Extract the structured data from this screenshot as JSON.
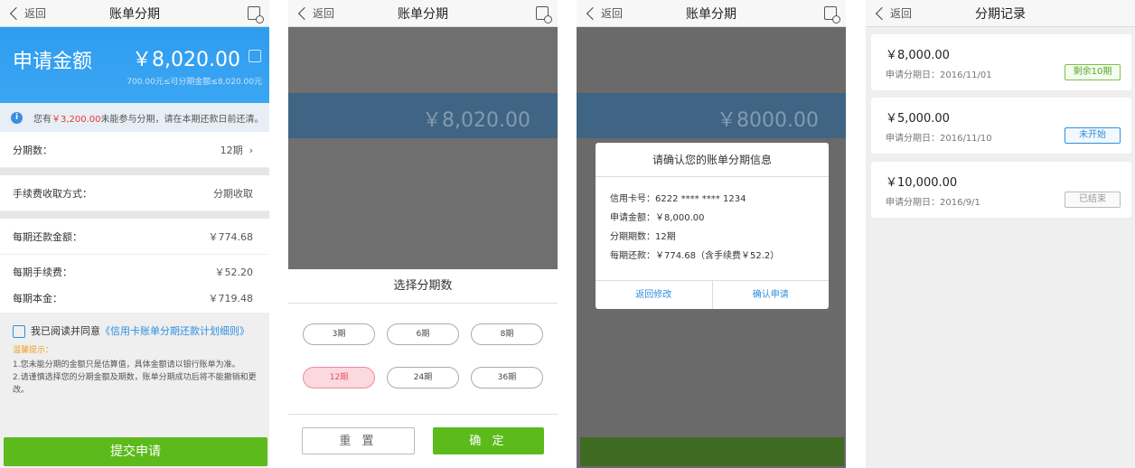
{
  "screen1": {
    "back": "返回",
    "title": "账单分期",
    "hero_label": "申请金额",
    "hero_amount": "￥8,020.00",
    "hero_range": "700.00元≤可分期金额≤8,020.00元",
    "notice_pre": "您有",
    "notice_amount": "￥3,200.00",
    "notice_post": "未能参与分期，请在本期还款日前还清。",
    "rows": [
      {
        "label": "分期数：",
        "value": "12期"
      },
      {
        "label": "手续费收取方式：",
        "value": "分期收取"
      },
      {
        "label": "每期还款金额：",
        "value": "￥774.68"
      },
      {
        "label": "每期手续费：",
        "value": "￥52.20"
      },
      {
        "label": "每期本金：",
        "value": "￥719.48"
      }
    ],
    "agree_text": "我已阅读并同意",
    "agree_link": "《信用卡账单分期还款计划细则》",
    "tips_title": "温馨提示：",
    "tip1": "1.您未能分期的金额只是估算值，具体金额请以银行账单为准。",
    "tip2": "2.请谨慎选择您的分期金额及期数，账单分期成功后将不能撤销和更改。",
    "submit": "提交申请"
  },
  "screen2": {
    "back": "返回",
    "title": "账单分期",
    "ghost_amount": "￥8,020.00",
    "sheet_title": "选择分期数",
    "options": [
      "3期",
      "6期",
      "8期",
      "12期",
      "24期",
      "36期"
    ],
    "selected": "12期",
    "reset": "重 置",
    "confirm": "确 定"
  },
  "screen3": {
    "back": "返回",
    "title": "账单分期",
    "ghost_amount": "￥8000.00",
    "dialog_title": "请确认您的账单分期信息",
    "lines": [
      "信用卡号：6222 **** **** 1234",
      "申请金额：￥8,000.00",
      "分期期数：12期",
      "每期还款：￥774.68（含手续费￥52.2）"
    ],
    "btn_back": "返回修改",
    "btn_confirm": "确认申请"
  },
  "screen4": {
    "back": "返回",
    "title": "分期记录",
    "records": [
      {
        "amount": "￥8,000.00",
        "date": "申请分期日：2016/11/01",
        "status": "剩余10期"
      },
      {
        "amount": "￥5,000.00",
        "date": "申请分期日：2016/11/10",
        "status": "未开始"
      },
      {
        "amount": "￥10,000.00",
        "date": "申请分期日：2016/9/1",
        "status": "已结束"
      }
    ]
  },
  "colors": {
    "primary_blue": "#2f9cf0",
    "green": "#5dba1c",
    "red": "#e53935"
  }
}
